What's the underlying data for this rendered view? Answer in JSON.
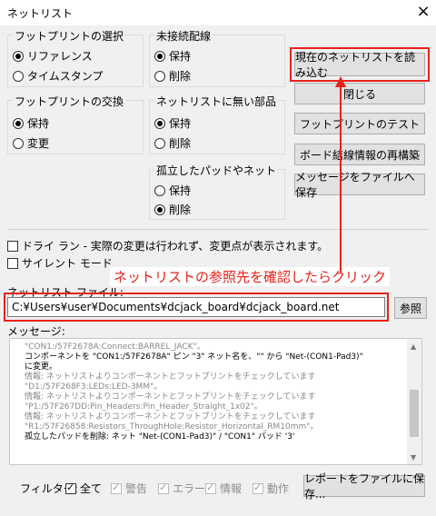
{
  "window": {
    "title": "ネットリスト",
    "close_icon": "×"
  },
  "groups": {
    "fp_select": {
      "label": "フットプリントの選択",
      "options": [
        "リファレンス",
        "タイムスタンプ"
      ],
      "selected": 0
    },
    "unconnected": {
      "label": "未接続配線",
      "options": [
        "保持",
        "削除"
      ],
      "selected": 0
    },
    "fp_exchange": {
      "label": "フットプリントの交換",
      "options": [
        "保持",
        "変更"
      ],
      "selected": 0
    },
    "missing_parts": {
      "label": "ネットリストに無い部品",
      "options": [
        "保持",
        "削除"
      ],
      "selected": 0
    },
    "isolated": {
      "label": "孤立したパッドやネット",
      "options": [
        "保持",
        "削除"
      ],
      "selected": 1
    }
  },
  "buttons": {
    "read_netlist": "現在のネットリストを読み込む",
    "close": "閉じる",
    "test_fp": "フットプリントのテスト",
    "rebuild": "ボード結線情報の再構築",
    "save_msg": "メッセージをファイルへ保存",
    "browse": "参照",
    "save_report": "レポートをファイルに保存..."
  },
  "checks": {
    "dry_run": "ドライ ラン - 実際の変更は行われず、変更点が表示されます。",
    "silent": "サイレント モード"
  },
  "netlist_file": {
    "label": "ネットリスト ファイル:",
    "value": "C:¥Users¥user¥Documents¥dcjack_board¥dcjack_board.net"
  },
  "annotation": "ネットリストの参照先を確認したらクリック",
  "messages": {
    "label": "メッセージ:",
    "lines": [
      "\"CON1:/57F2678A:Connect:BARREL_JACK\"。",
      "コンポーネントを \"CON1:/57F2678A\" ピン \"3\" ネット名を、\"\" から \"Net-(CON1-Pad3)\"",
      "に変更。",
      "情報: ネットリストよりコンポーネントとフットプリントをチェックしています",
      "\"D1:/57F268F3:LEDs:LED-3MM\"。",
      "情報: ネットリストよりコンポーネントとフットプリントをチェックしています",
      "\"P1:/57F267DD:Pin_Headers:Pin_Header_Straight_1x02\"。",
      "情報: ネットリストよりコンポーネントとフットプリントをチェックしています",
      "\"R1:/57F26858:Resistors_ThroughHole:Resistor_Horizontal_RM10mm\"。",
      "孤立したパッドを削除: ネット \"Net-(CON1-Pad3)\" / \"CON1\" パッド '3'"
    ]
  },
  "filter": {
    "label": "フィルター:",
    "all": "全て",
    "warning": "警告",
    "error": "エラー",
    "info": "情報",
    "action": "動作"
  },
  "colors": {
    "annotation_red": "#e8221b"
  }
}
